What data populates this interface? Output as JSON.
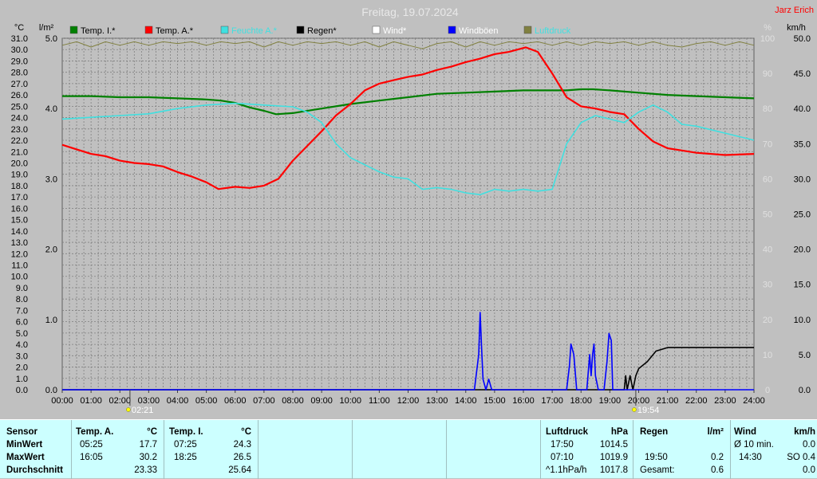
{
  "header": {
    "title": "Freitag, 19.07.2024",
    "author": "Jarz Erich",
    "unit_left_temp": "°C",
    "unit_left_rain": "l/m²",
    "unit_right_pct": "%",
    "unit_right_wind": "km/h"
  },
  "colors": {
    "background": "#c0c0c0",
    "plot_bg": "#c0c0c0",
    "grid": "#7f7f7f",
    "temp_inside": "#008000",
    "temp_outside": "#ff0000",
    "humidity": "#40e0e0",
    "rain": "#000000",
    "wind": "#ffffff",
    "gusts": "#0000ff",
    "pressure": "#808040",
    "axis_text_temp": "#000000",
    "axis_text_light": "#e0e0e0",
    "author": "#ff0000",
    "panel": "#ccffff"
  },
  "chart_data": {
    "type": "line",
    "title": "Freitag, 19.07.2024",
    "x": [
      "00:00",
      "01:00",
      "02:00",
      "03:00",
      "04:00",
      "05:00",
      "06:00",
      "07:00",
      "08:00",
      "09:00",
      "10:00",
      "11:00",
      "12:00",
      "13:00",
      "14:00",
      "15:00",
      "16:00",
      "17:00",
      "18:00",
      "19:00",
      "20:00",
      "21:00",
      "22:00",
      "23:00",
      "24:00"
    ],
    "xlim_hours": [
      0,
      24
    ],
    "axes": {
      "temp": {
        "label": "°C",
        "min": 0.0,
        "max": 31.0,
        "ticks": [
          "0.0",
          "1.0",
          "2.0",
          "3.0",
          "4.0",
          "5.0",
          "6.0",
          "7.0",
          "8.0",
          "9.0",
          "10.0",
          "11.0",
          "12.0",
          "13.0",
          "14.0",
          "15.0",
          "16.0",
          "17.0",
          "18.0",
          "19.0",
          "20.0",
          "21.0",
          "22.0",
          "23.0",
          "24.0",
          "25.0",
          "26.0",
          "27.0",
          "28.0",
          "29.0",
          "30.0",
          "31.0"
        ]
      },
      "rain": {
        "label": "l/m²",
        "min": 0.0,
        "max": 5.0,
        "ticks": [
          "0.0",
          "1.0",
          "2.0",
          "3.0",
          "4.0",
          "5.0"
        ]
      },
      "humidity": {
        "label": "%",
        "min": 0,
        "max": 100,
        "ticks": [
          "0",
          "10",
          "20",
          "30",
          "40",
          "50",
          "60",
          "70",
          "80",
          "90",
          "100"
        ]
      },
      "wind": {
        "label": "km/h",
        "min": 0.0,
        "max": 50.0,
        "ticks": [
          "0.0",
          "5.0",
          "10.0",
          "15.0",
          "20.0",
          "25.0",
          "30.0",
          "35.0",
          "40.0",
          "45.0",
          "50.0"
        ]
      }
    },
    "grid": true,
    "legend_position": "top",
    "legend": [
      "Temp. I.*",
      "Temp. A.*",
      "Feuchte A.*",
      "Regen*",
      "Wind*",
      "Windböen",
      "Luftdruck"
    ],
    "markers": [
      "02:21",
      "19:54"
    ],
    "series": [
      {
        "name": "Temp. I.*",
        "axis": "temp",
        "color": "#008000",
        "points": [
          [
            0,
            25.9
          ],
          [
            1,
            25.9
          ],
          [
            2,
            25.8
          ],
          [
            3,
            25.8
          ],
          [
            4,
            25.7
          ],
          [
            5,
            25.6
          ],
          [
            5.5,
            25.5
          ],
          [
            6,
            25.3
          ],
          [
            6.5,
            24.9
          ],
          [
            7,
            24.6
          ],
          [
            7.42,
            24.3
          ],
          [
            8,
            24.4
          ],
          [
            9,
            24.8
          ],
          [
            10,
            25.2
          ],
          [
            11,
            25.5
          ],
          [
            12,
            25.8
          ],
          [
            13,
            26.1
          ],
          [
            14,
            26.2
          ],
          [
            15,
            26.3
          ],
          [
            16,
            26.4
          ],
          [
            17,
            26.4
          ],
          [
            17.5,
            26.4
          ],
          [
            18,
            26.5
          ],
          [
            18.42,
            26.5
          ],
          [
            19,
            26.4
          ],
          [
            20,
            26.2
          ],
          [
            21,
            26.0
          ],
          [
            22,
            25.9
          ],
          [
            23,
            25.8
          ],
          [
            24,
            25.7
          ]
        ]
      },
      {
        "name": "Temp. A.*",
        "axis": "temp",
        "color": "#ff0000",
        "points": [
          [
            0,
            21.6
          ],
          [
            0.5,
            21.2
          ],
          [
            1,
            20.8
          ],
          [
            1.5,
            20.6
          ],
          [
            2,
            20.2
          ],
          [
            2.5,
            20.0
          ],
          [
            3,
            19.9
          ],
          [
            3.5,
            19.7
          ],
          [
            4,
            19.2
          ],
          [
            4.5,
            18.8
          ],
          [
            5,
            18.3
          ],
          [
            5.42,
            17.7
          ],
          [
            6,
            17.9
          ],
          [
            6.5,
            17.8
          ],
          [
            7,
            18.0
          ],
          [
            7.5,
            18.6
          ],
          [
            8,
            20.2
          ],
          [
            8.5,
            21.5
          ],
          [
            9,
            22.8
          ],
          [
            9.5,
            24.2
          ],
          [
            10,
            25.2
          ],
          [
            10.5,
            26.4
          ],
          [
            11,
            27.0
          ],
          [
            11.5,
            27.3
          ],
          [
            12,
            27.6
          ],
          [
            12.5,
            27.8
          ],
          [
            13,
            28.2
          ],
          [
            13.5,
            28.5
          ],
          [
            14,
            28.9
          ],
          [
            14.5,
            29.2
          ],
          [
            15,
            29.6
          ],
          [
            15.5,
            29.8
          ],
          [
            16.08,
            30.2
          ],
          [
            16.5,
            29.8
          ],
          [
            17,
            27.9
          ],
          [
            17.5,
            25.8
          ],
          [
            18,
            25.0
          ],
          [
            18.5,
            24.8
          ],
          [
            19,
            24.5
          ],
          [
            19.5,
            24.3
          ],
          [
            20,
            23.0
          ],
          [
            20.5,
            21.9
          ],
          [
            21,
            21.3
          ],
          [
            21.5,
            21.1
          ],
          [
            22,
            20.9
          ],
          [
            23,
            20.7
          ],
          [
            24,
            20.8
          ]
        ]
      },
      {
        "name": "Feuchte A.*",
        "axis": "humidity",
        "color": "#40e0e0",
        "points": [
          [
            0,
            77
          ],
          [
            1,
            77.5
          ],
          [
            2,
            78
          ],
          [
            3,
            78.5
          ],
          [
            4,
            80
          ],
          [
            5,
            81
          ],
          [
            6,
            81.5
          ],
          [
            7,
            81
          ],
          [
            8,
            80.5
          ],
          [
            8.5,
            79
          ],
          [
            9,
            76
          ],
          [
            9.5,
            70
          ],
          [
            10,
            66
          ],
          [
            10.5,
            64
          ],
          [
            11,
            62
          ],
          [
            11.5,
            60.5
          ],
          [
            12,
            60
          ],
          [
            12.5,
            57
          ],
          [
            13,
            57.5
          ],
          [
            13.5,
            57
          ],
          [
            14,
            56
          ],
          [
            14.5,
            55.5
          ],
          [
            15,
            57
          ],
          [
            15.5,
            56.5
          ],
          [
            16,
            57
          ],
          [
            16.5,
            56.5
          ],
          [
            17,
            57
          ],
          [
            17.5,
            70
          ],
          [
            18,
            76
          ],
          [
            18.5,
            78
          ],
          [
            19,
            77
          ],
          [
            19.5,
            76
          ],
          [
            20,
            79
          ],
          [
            20.5,
            81
          ],
          [
            21,
            79
          ],
          [
            21.5,
            75.5
          ],
          [
            22,
            75
          ],
          [
            22.5,
            74
          ],
          [
            23,
            73
          ],
          [
            24,
            71
          ]
        ]
      },
      {
        "name": "Regen*",
        "axis": "rain",
        "color": "#000000",
        "points": [
          [
            0,
            0
          ],
          [
            19.5,
            0
          ],
          [
            19.55,
            0.2
          ],
          [
            19.6,
            0.0
          ],
          [
            19.7,
            0.2
          ],
          [
            19.8,
            0.0
          ],
          [
            19.9,
            0.2
          ],
          [
            20.0,
            0.3
          ],
          [
            20.3,
            0.4
          ],
          [
            20.6,
            0.55
          ],
          [
            21,
            0.6
          ],
          [
            22,
            0.6
          ],
          [
            23,
            0.6
          ],
          [
            24,
            0.6
          ]
        ]
      },
      {
        "name": "Windböen",
        "axis": "wind",
        "color": "#0000ff",
        "points": [
          [
            0,
            0
          ],
          [
            14.3,
            0
          ],
          [
            14.45,
            5
          ],
          [
            14.5,
            11
          ],
          [
            14.55,
            6
          ],
          [
            14.6,
            1.5
          ],
          [
            14.7,
            0
          ],
          [
            14.8,
            1.5
          ],
          [
            14.9,
            0
          ],
          [
            17.5,
            0
          ],
          [
            17.6,
            3.5
          ],
          [
            17.65,
            6.5
          ],
          [
            17.75,
            5
          ],
          [
            17.85,
            0
          ],
          [
            18.2,
            0
          ],
          [
            18.3,
            5
          ],
          [
            18.35,
            2
          ],
          [
            18.4,
            5
          ],
          [
            18.45,
            6.5
          ],
          [
            18.5,
            2
          ],
          [
            18.6,
            0
          ],
          [
            18.8,
            0
          ],
          [
            18.9,
            4
          ],
          [
            18.97,
            8
          ],
          [
            19.05,
            7
          ],
          [
            19.1,
            0
          ],
          [
            24,
            0
          ]
        ]
      },
      {
        "name": "Luftdruck",
        "axis": "humidity",
        "color": "#808040",
        "points": [
          [
            0,
            98
          ],
          [
            0.5,
            99
          ],
          [
            1,
            97.5
          ],
          [
            1.5,
            99
          ],
          [
            2,
            98
          ],
          [
            2.5,
            99
          ],
          [
            3,
            98
          ],
          [
            3.5,
            99
          ],
          [
            4,
            98.5
          ],
          [
            4.5,
            99
          ],
          [
            5,
            98
          ],
          [
            5.5,
            99
          ],
          [
            6,
            98.5
          ],
          [
            6.5,
            99
          ],
          [
            7,
            97.5
          ],
          [
            7.5,
            99
          ],
          [
            8,
            98
          ],
          [
            8.5,
            99
          ],
          [
            9,
            98.5
          ],
          [
            9.5,
            99
          ],
          [
            10,
            98
          ],
          [
            10.5,
            99
          ],
          [
            11,
            97.5
          ],
          [
            11.5,
            99
          ],
          [
            12,
            98
          ],
          [
            12.5,
            97
          ],
          [
            13,
            98.5
          ],
          [
            13.5,
            99
          ],
          [
            14,
            97.5
          ],
          [
            14.5,
            99
          ],
          [
            15,
            98
          ],
          [
            15.5,
            99
          ],
          [
            16,
            98.5
          ],
          [
            16.5,
            99
          ],
          [
            17,
            98
          ],
          [
            17.5,
            99
          ],
          [
            18,
            98
          ],
          [
            18.5,
            99
          ],
          [
            19,
            98.5
          ],
          [
            19.5,
            99
          ],
          [
            20,
            98
          ],
          [
            20.5,
            99
          ],
          [
            21,
            98
          ],
          [
            21.5,
            97.5
          ],
          [
            22,
            98.5
          ],
          [
            22.5,
            99
          ],
          [
            23,
            98
          ],
          [
            23.5,
            99
          ],
          [
            24,
            98
          ]
        ]
      }
    ]
  },
  "panel": {
    "sensor": {
      "title": "Sensor",
      "rows": [
        "MinWert",
        "MaxWert",
        "Durchschnitt"
      ]
    },
    "temp_a": {
      "title": "Temp. A.",
      "unit": "°C",
      "times": [
        "05:25",
        "16:05",
        ""
      ],
      "values": [
        "17.7",
        "30.2",
        "23.33"
      ]
    },
    "temp_i": {
      "title": "Temp. I.",
      "unit": "°C",
      "times": [
        "07:25",
        "18:25",
        ""
      ],
      "values": [
        "24.3",
        "26.5",
        "25.64"
      ]
    },
    "pressure": {
      "title": "Luftdruck",
      "unit": "hPa",
      "times": [
        "17:50",
        "07:10",
        "^1.1hPa/h"
      ],
      "values": [
        "1014.5",
        "1019.9",
        "1017.8"
      ]
    },
    "rain": {
      "title": "Regen",
      "unit": "l/m²",
      "times": [
        "",
        "19:50",
        "Gesamt:"
      ],
      "values": [
        "",
        "0.2",
        "0.6"
      ]
    },
    "wind": {
      "title": "Wind",
      "unit": "km/h",
      "times": [
        "Ø 10 min.",
        "14:30",
        ""
      ],
      "values": [
        "0.0",
        "SO 0.4",
        "0.0"
      ]
    }
  }
}
